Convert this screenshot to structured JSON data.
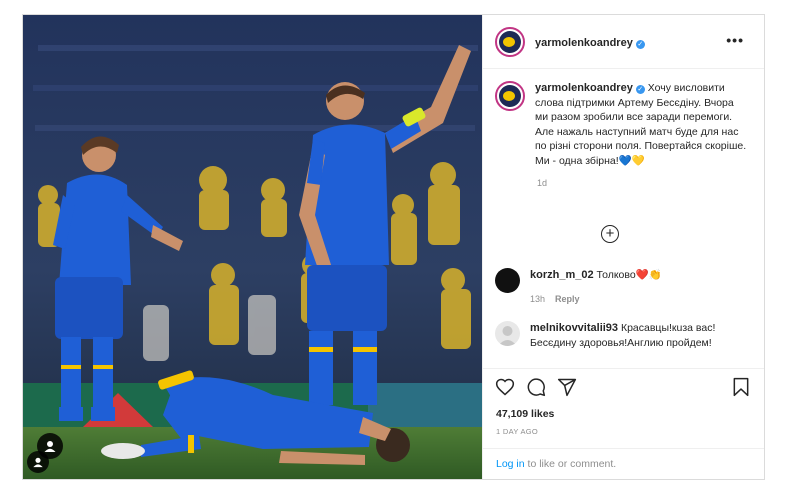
{
  "post": {
    "username": "yarmolenkoandrey",
    "verified_mark": "✓",
    "more_label": "•••",
    "caption": "Хочу висловити слова підтримки Артему Бесєдіну. Вчора ми разом зробили все заради перемоги. Але нажаль наступний матч буде для нас по різні сторони поля. Повертайся скоріше. Ми - одна збірна!💙💛",
    "caption_time": "1d",
    "load_more_label": "+"
  },
  "comments": [
    {
      "username": "korzh_m_02",
      "text": "Толково❤️👏",
      "time": "13h",
      "reply_label": "Reply",
      "avatar_color": "#111111"
    },
    {
      "username": "melnikovvitalii93",
      "text": "Красавцы!кuза вас! Бесєдину здоровья!Англию пройдем!",
      "avatar_color": "#e8e8e8"
    }
  ],
  "actions": {
    "icons": [
      "heart-icon",
      "comment-icon",
      "share-icon",
      "bookmark-icon"
    ],
    "likes": "47,109 likes",
    "time_ago": "1 DAY AGO"
  },
  "login": {
    "link_text": "Log in",
    "rest_text": " to like or comment."
  },
  "colors": {
    "kit_blue": "#1f5fd6",
    "kit_yellow": "#f4c400",
    "pitch_green": "#3a6a2c",
    "link_blue": "#0095f6",
    "story_ring": "#c13584"
  }
}
